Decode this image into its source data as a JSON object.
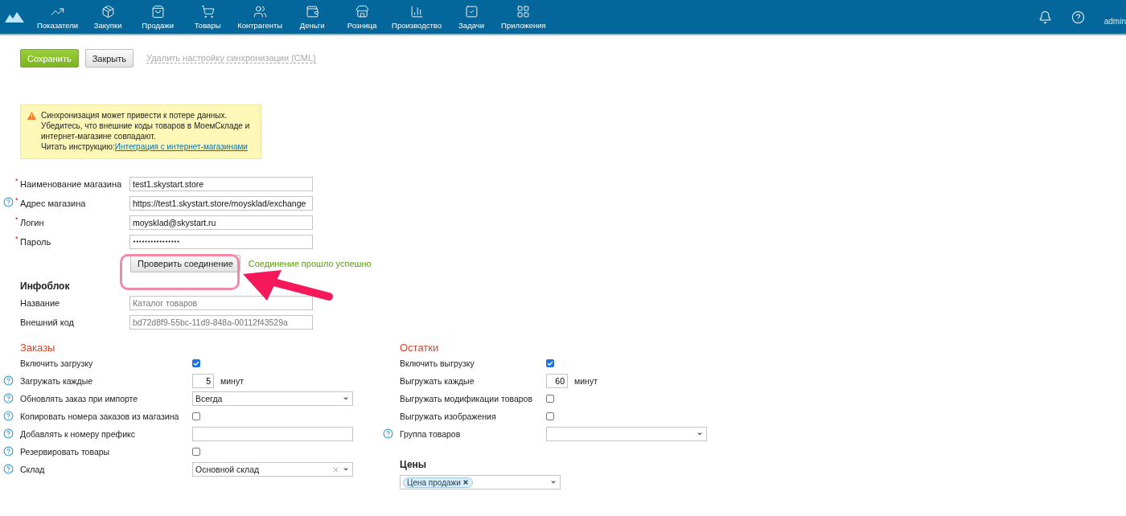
{
  "nav": {
    "items": [
      {
        "label": "Показатели"
      },
      {
        "label": "Закупки"
      },
      {
        "label": "Продажи"
      },
      {
        "label": "Товары"
      },
      {
        "label": "Контрагенты"
      },
      {
        "label": "Деньги"
      },
      {
        "label": "Розница"
      },
      {
        "label": "Производство"
      },
      {
        "label": "Задачи"
      },
      {
        "label": "Приложения"
      }
    ],
    "user": "admin"
  },
  "toolbar": {
    "save": "Сохранить",
    "close": "Закрыть",
    "delete_link": "Удалить настройку синхронизации (CML)"
  },
  "warning": {
    "text": "Синхронизация может привести к потере данных. Убедитесь, что внешние коды товаров в МоемСкладе и интернет-магазине совпадают.",
    "read_label": "Читать инструкцию:",
    "link": "Интеграция с интернет-магазинами"
  },
  "connection": [
    {
      "label": "Наименование магазина",
      "required_mark": "*",
      "help": false,
      "kind": "text",
      "value": "test1.skystart.store"
    },
    {
      "label": "Адрес магазина",
      "required_mark": "*",
      "help": true,
      "kind": "text",
      "value": "https://test1.skystart.store/moysklad/exchange"
    },
    {
      "label": "Логин",
      "required_mark": "*",
      "help": false,
      "kind": "text",
      "value": "moysklad@skystart.ru"
    },
    {
      "label": "Пароль",
      "required_mark": "*",
      "help": false,
      "kind": "password",
      "value": "••••••••••••••••"
    }
  ],
  "check": {
    "button": "Проверить соединение",
    "status": "Соединение прошло успешно",
    "highlighted": true
  },
  "infoblock": {
    "title": "Инфоблок",
    "fields": [
      {
        "label": "Название",
        "help": false,
        "kind": "text",
        "value": "Каталог товаров",
        "disabled": true
      },
      {
        "label": "Внешний код",
        "help": false,
        "kind": "text",
        "value": "bd72d8f9-55bc-11d9-848a-00112f43529a",
        "disabled": true
      }
    ]
  },
  "orders": {
    "title": "Заказы",
    "fields": [
      {
        "label": "Включить загрузку",
        "help": false,
        "kind": "checkbox",
        "checked": true
      },
      {
        "label": "Загружать каждые",
        "help": true,
        "kind": "number",
        "value": "5",
        "unit": "минут"
      },
      {
        "label": "Обновлять заказ при импорте",
        "help": true,
        "kind": "select",
        "value": "Всегда",
        "clearable": false
      },
      {
        "label": "Копировать номера заказов из магазина",
        "help": true,
        "kind": "checkbox",
        "checked": false
      },
      {
        "label": "Добавлять к номеру префикс",
        "help": true,
        "kind": "text"
      },
      {
        "label": "Резервировать товары",
        "help": true,
        "kind": "checkbox",
        "checked": false
      },
      {
        "label": "Склад",
        "help": true,
        "kind": "select",
        "value": "Основной склад",
        "clearable": true
      }
    ]
  },
  "stock": {
    "title": "Остатки",
    "fields": [
      {
        "label": "Включить выгрузку",
        "help": false,
        "kind": "checkbox",
        "checked": true
      },
      {
        "label": "Выгружать каждые",
        "help": false,
        "kind": "number",
        "value": "60",
        "unit": "минут"
      },
      {
        "label": "Выгружать модификации товаров",
        "help": false,
        "kind": "checkbox",
        "checked": false
      },
      {
        "label": "Выгружать изображения",
        "help": false,
        "kind": "checkbox",
        "checked": false
      },
      {
        "label": "Группа товаров",
        "help": true,
        "kind": "select",
        "clearable": false
      }
    ]
  },
  "prices": {
    "title": "Цены",
    "tags": [
      "Цена продажи"
    ]
  }
}
